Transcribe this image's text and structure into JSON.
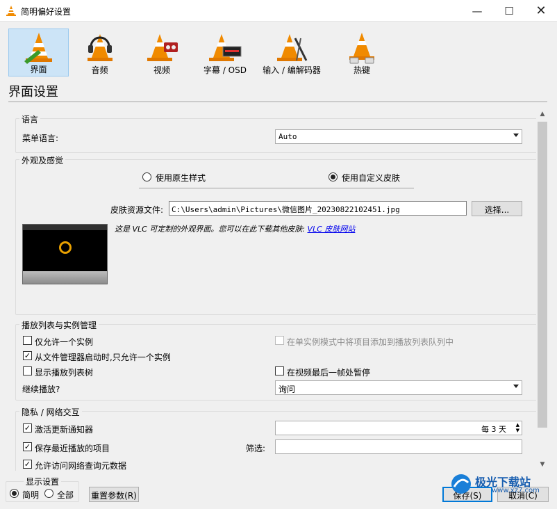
{
  "window": {
    "title": "简明偏好设置"
  },
  "categories": [
    {
      "label": "界面",
      "icon": "interface-cone-icon"
    },
    {
      "label": "音频",
      "icon": "audio-cone-headphones-icon"
    },
    {
      "label": "视频",
      "icon": "video-cone-icon"
    },
    {
      "label": "字幕 / OSD",
      "icon": "subtitles-cone-icon"
    },
    {
      "label": "输入 / 编解码器",
      "icon": "input-codecs-cone-icon"
    },
    {
      "label": "热键",
      "icon": "hotkeys-cone-icon"
    }
  ],
  "section_title": "界面设置",
  "language": {
    "group": "语言",
    "menu_language_label": "菜单语言:",
    "menu_language_value": "Auto"
  },
  "look": {
    "group": "外观及感觉",
    "native_style": "使用原生样式",
    "custom_skin": "使用自定义皮肤",
    "skin_file_label": "皮肤资源文件:",
    "skin_file_value": "C:\\Users\\admin\\Pictures\\微信图片_20230822102451.jpg",
    "choose_button": "选择...",
    "skin_note": "这是 VLC 可定制的外观界面。您可以在此下载其他皮肤:",
    "skin_link": "VLC 皮肤网站"
  },
  "playlist": {
    "group": "播放列表与实例管理",
    "one_instance": "仅允许一个实例",
    "enqueue_single": "在单实例模式中将项目添加到播放列表队列中",
    "one_instance_fm": "从文件管理器启动时,只允许一个实例",
    "show_tree": "显示播放列表树",
    "pause_last": "在视频最后一帧处暂停",
    "resume_label": "继续播放?",
    "resume_value": "询问"
  },
  "privacy": {
    "group": "隐私 / 网络交互",
    "update_notifier": "激活更新通知器",
    "update_every": "每 3 天",
    "save_recent": "保存最近播放的项目",
    "filter_label": "筛选:",
    "allow_metadata": "允许访问网络查询元数据"
  },
  "bottom": {
    "display_group": "显示设置",
    "simple": "简明",
    "all": "全部",
    "reset": "重置参数(R)",
    "save": "保存(S)",
    "cancel": "取消(C)"
  },
  "watermark": {
    "text": "极光下载站",
    "url": "www.xz7.com"
  },
  "colors": {
    "accent": "#0078d7",
    "selected_bg": "#cce4f7",
    "vlc_orange": "#f08a00"
  }
}
